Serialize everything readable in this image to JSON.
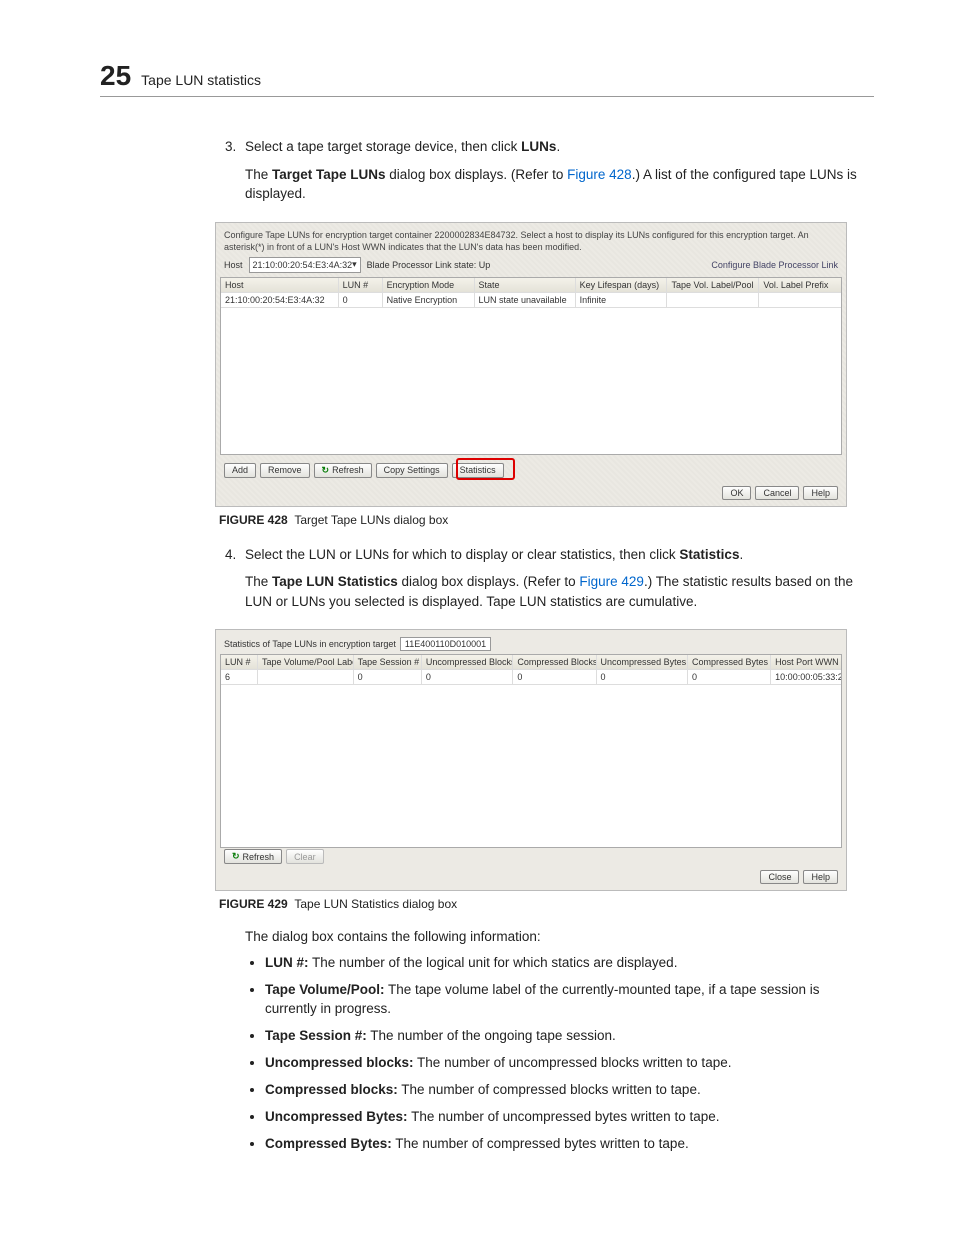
{
  "header": {
    "chapter_num": "25",
    "title": "Tape LUN statistics"
  },
  "step3": {
    "num": "3.",
    "text_a": "Select a tape target storage device, then click ",
    "text_b": "LUNs",
    "text_c": ".",
    "para_a": "The ",
    "para_b": "Target Tape LUNs",
    "para_c": " dialog box displays. (Refer to ",
    "para_link": "Figure 428",
    "para_d": ".) A list of the configured tape LUNs is displayed."
  },
  "fig428": {
    "desc": "Configure Tape LUNs for encryption target container 2200002834E84732. Select a host to display its LUNs configured for this encryption target. An asterisk(*) in front of a LUN's Host WWN indicates that the LUN's data has been modified.",
    "host_label": "Host",
    "host_value": "21:10:00:20:54:E3:4A:32",
    "bp_state_label": "Blade Processor Link state: Up",
    "configure_link": "Configure Blade Processor Link",
    "cols": [
      "Host",
      "LUN #",
      "Encryption Mode",
      "State",
      "Key Lifespan (days)",
      "Tape Vol. Label/Pool",
      "Vol. Label Prefix"
    ],
    "row": [
      "21:10:00:20:54:E3:4A:32",
      "0",
      "Native Encryption",
      "LUN state unavailable",
      "Infinite",
      "",
      ""
    ],
    "btns": {
      "add": "Add",
      "remove": "Remove",
      "refresh": "Refresh",
      "copy": "Copy Settings",
      "stats": "Statistics",
      "ok": "OK",
      "cancel": "Cancel",
      "help": "Help"
    },
    "caption_num": "FIGURE 428",
    "caption": "Target Tape LUNs dialog box"
  },
  "step4": {
    "num": "4.",
    "text_a": "Select the LUN or LUNs for which to display or clear statistics, then click ",
    "text_b": "Statistics",
    "text_c": ".",
    "para_a": "The ",
    "para_b": "Tape LUN Statistics",
    "para_c": " dialog box displays. (Refer to ",
    "para_link": "Figure 429",
    "para_d": ".) The statistic results based on the LUN or LUNs you selected is displayed. Tape LUN statistics are cumulative."
  },
  "fig429": {
    "head_label": "Statistics of Tape LUNs in encryption target",
    "head_value": "11E400110D010001",
    "cols": [
      "LUN #",
      "Tape Volume/Pool Label",
      "Tape Session #",
      "Uncompressed Blocks",
      "Compressed Blocks",
      "Uncompressed Bytes",
      "Compressed Bytes",
      "Host Port WWN"
    ],
    "row": [
      "6",
      "",
      "0",
      "0",
      "0",
      "0",
      "0",
      "10:00:00:05:33:2..."
    ],
    "btns": {
      "refresh": "Refresh",
      "clear": "Clear",
      "close": "Close",
      "help": "Help"
    },
    "caption_num": "FIGURE 429",
    "caption": "Tape LUN Statistics dialog box"
  },
  "info_intro": "The dialog box contains the following information:",
  "bullets": [
    {
      "term": "LUN #:",
      "desc": " The number of the logical unit for which statics are displayed."
    },
    {
      "term": "Tape Volume/Pool:",
      "desc": " The tape volume label of the currently-mounted tape, if a tape session is currently in progress."
    },
    {
      "term": "Tape Session #:",
      "desc": " The number of the ongoing tape session."
    },
    {
      "term": "Uncompressed blocks:",
      "desc": " The number of uncompressed blocks written to tape."
    },
    {
      "term": "Compressed blocks:",
      "desc": " The number of compressed blocks written to tape."
    },
    {
      "term": "Uncompressed Bytes:",
      "desc": " The number of uncompressed bytes written to tape."
    },
    {
      "term": "Compressed Bytes:",
      "desc": " The number of compressed bytes written to tape."
    }
  ]
}
